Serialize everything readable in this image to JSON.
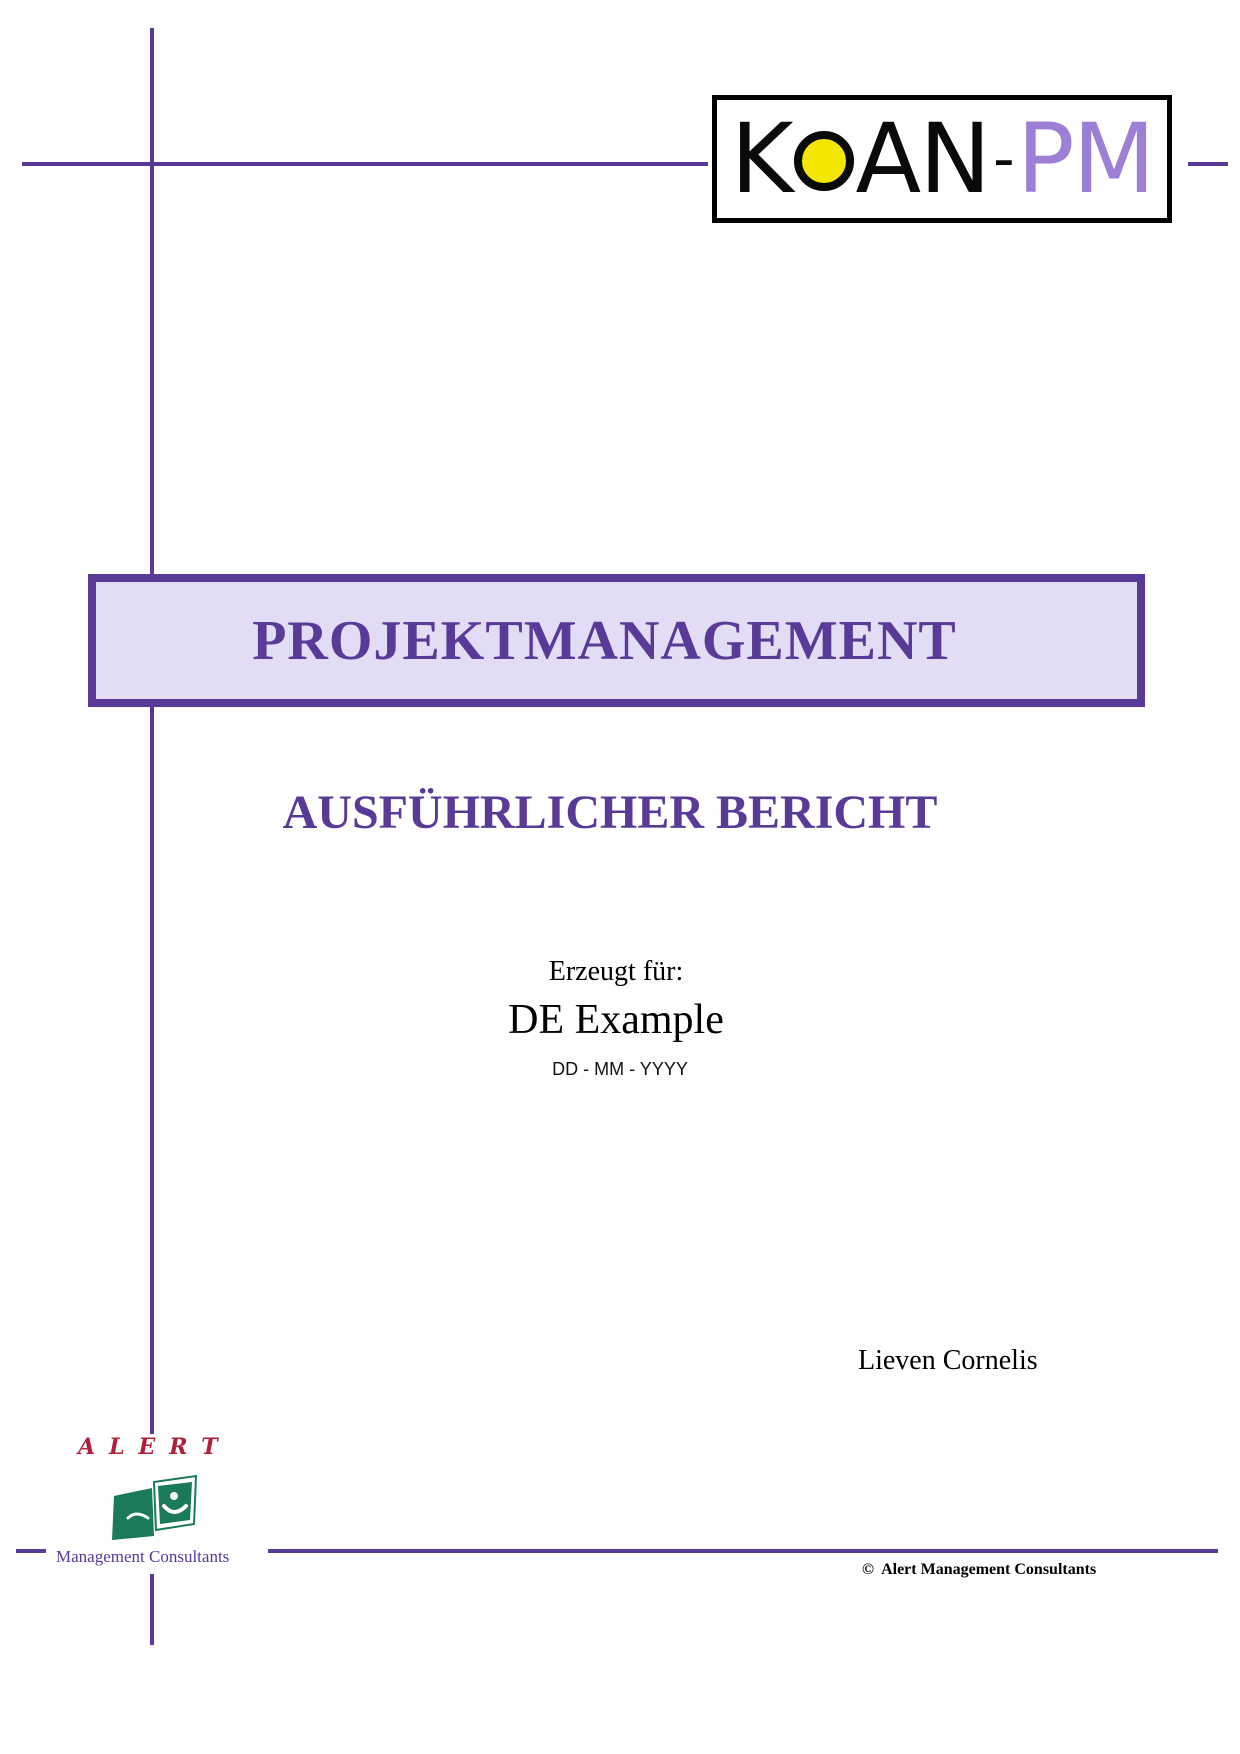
{
  "logos": {
    "koan": {
      "part1": "K",
      "part2": "AN",
      "dash": "-",
      "part3": "PM",
      "colors": {
        "text": "#0a0a0a",
        "circle": "#f3e600",
        "pm": "#9d7fd6"
      }
    },
    "alert": {
      "name": "ALERT",
      "tagline": "Management Consultants",
      "colors": {
        "name": "#b0203a",
        "mark": "#1b7a5a"
      }
    }
  },
  "document": {
    "title": "PROJEKTMANAGEMENT",
    "subtitle": "AUSFÜHRLICHER BERICHT",
    "generated_for_label": "Erzeugt für:",
    "client": "DE Example",
    "date": "DD - MM - YYYY",
    "author": "Lieven Cornelis",
    "copyright_symbol": "©",
    "copyright_holder": "Alert Management Consultants"
  },
  "colors": {
    "accent": "#5a3a97",
    "title_box_fill": "#e3dcf5"
  }
}
